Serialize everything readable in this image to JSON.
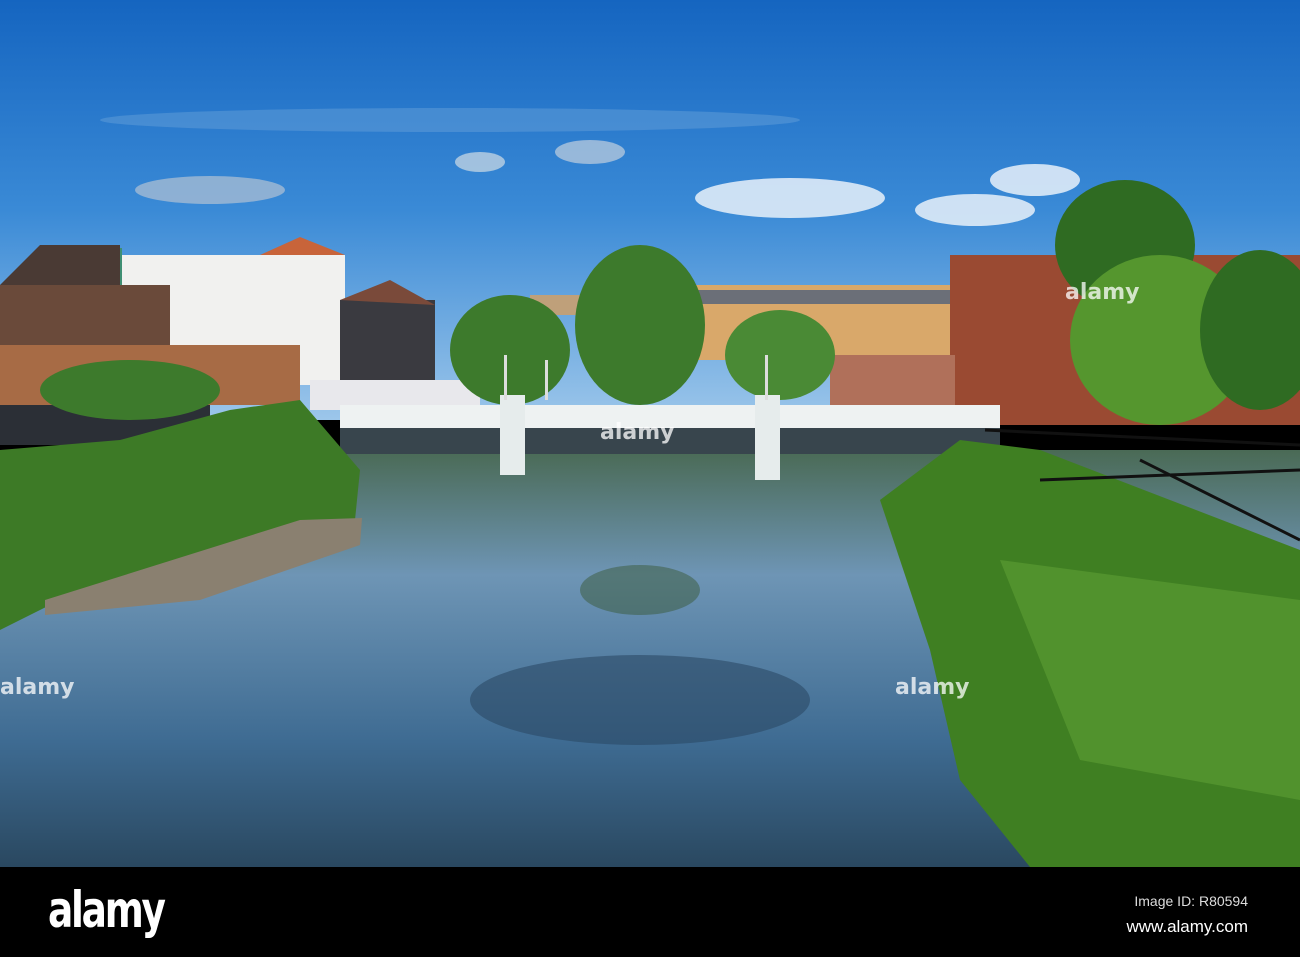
{
  "watermark": {
    "text": "alamy"
  },
  "footer": {
    "logo": "alamy",
    "image_id": "Image ID: R80594",
    "site": "www.alamy.com"
  },
  "colors": {
    "sky": "#1f72c4",
    "water": "#3a5f7e",
    "foliage": "#3f7a22",
    "footer": "#000000"
  }
}
